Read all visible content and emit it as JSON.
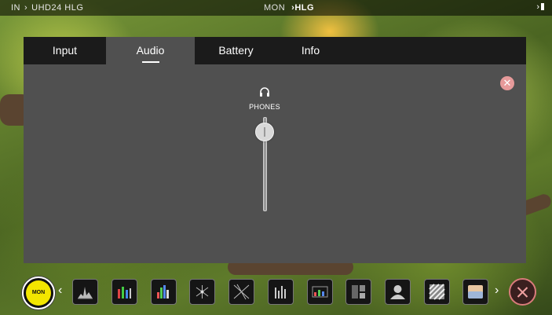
{
  "status_bar": {
    "input_label": "IN",
    "input_format": "UHD24 HLG",
    "monitor_label": "MON",
    "monitor_mode": "HLG",
    "battery_icon": "battery-icon"
  },
  "tabs": [
    {
      "label": "Input",
      "active": false
    },
    {
      "label": "Audio",
      "active": true
    },
    {
      "label": "Battery",
      "active": false
    },
    {
      "label": "Info",
      "active": false
    }
  ],
  "audio": {
    "phones_label": "PHONES",
    "phones_icon": "headphones-icon",
    "phones_volume_fraction": 0.85
  },
  "toolbar": {
    "mon_label": "MON",
    "left_arrow": "‹",
    "right_arrow": "›",
    "tools": [
      {
        "icon": "waveform-icon"
      },
      {
        "icon": "rgb-parade-icon"
      },
      {
        "icon": "histogram-icon"
      },
      {
        "icon": "vectorscope-icon"
      },
      {
        "icon": "vectorscope-zoom-icon"
      },
      {
        "icon": "audio-meters-icon"
      },
      {
        "icon": "false-color-icon"
      },
      {
        "icon": "focus-peaking-icon"
      },
      {
        "icon": "skin-tone-icon"
      },
      {
        "icon": "zebra-icon"
      },
      {
        "icon": "lut-icon"
      }
    ],
    "exit_icon": "close-icon"
  },
  "colors": {
    "mon_button": "#f3e600",
    "panel": "#505050",
    "tab_bar": "#1b1b1b",
    "close_button": "#e69a9a",
    "exit_ring": "#d97b7b"
  }
}
